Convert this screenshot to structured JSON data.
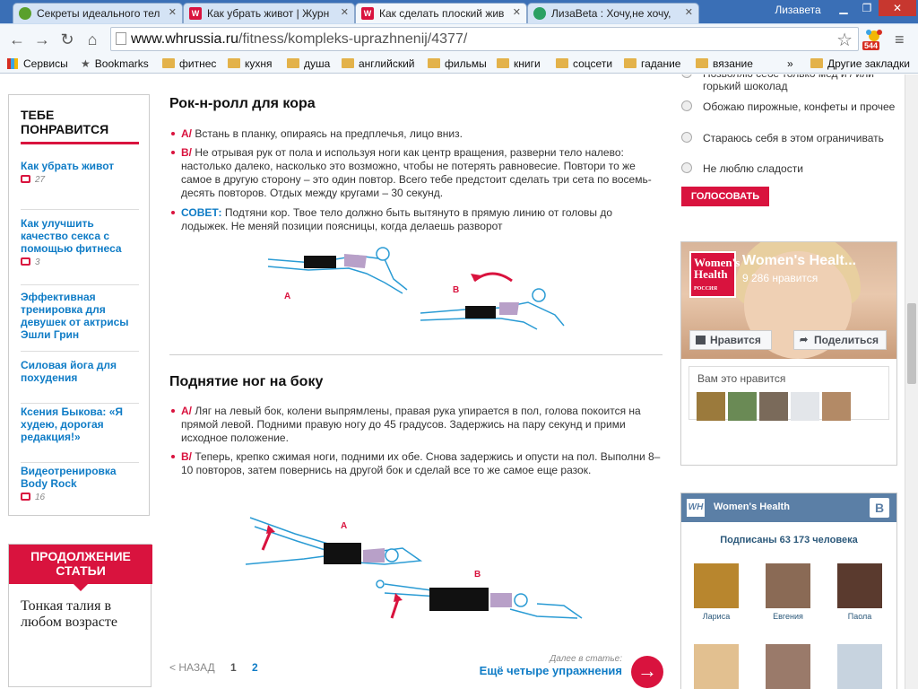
{
  "browser": {
    "tabs": [
      {
        "title": "Секреты идеального тел",
        "icon": "chrome-app-icon"
      },
      {
        "title": "Как убрать живот | Журн",
        "icon": "wh-favicon"
      },
      {
        "title": "Как сделать плоский жив",
        "icon": "wh-favicon"
      },
      {
        "title": "ЛизаBeta : Хочу,не хочу,",
        "icon": "liveinternet-favicon"
      }
    ],
    "user": "Лизавета",
    "url_domain": "www.whrussia.ru",
    "url_path": "/fitness/kompleks-uprazhnenij/4377/",
    "extension_badge": "544",
    "bookmarks": [
      "Сервисы",
      "Bookmarks",
      "фитнес",
      "кухня",
      "душа",
      "английский",
      "фильмы",
      "книги",
      "соцсети",
      "гадание",
      "вязание"
    ],
    "bookmarks_overflow": "»",
    "other_bookmarks": "Другие закладки"
  },
  "sidebar": {
    "title": "ТЕБЕ ПОНРАВИТСЯ",
    "items": [
      {
        "title": "Как убрать живот",
        "comments": "27"
      },
      {
        "title": "Как улучшить качество секса с помощью фитнеса",
        "comments": "3"
      },
      {
        "title": "Эффективная тренировка для девушек от актрисы Эшли Грин",
        "comments": ""
      },
      {
        "title": "Силовая йога для похудения",
        "comments": ""
      },
      {
        "title": "Ксения Быкова: «Я худею, дорогая редакция!»",
        "comments": ""
      },
      {
        "title": "Видеотренировка Body Rock",
        "comments": "16"
      }
    ],
    "continue_title": "ПРОДОЛЖЕНИЕ СТАТЬИ",
    "continue_text": "Тонкая талия в любом возрасте"
  },
  "article": {
    "section1": {
      "title": "Рок-н-ролл для кора",
      "a_label": "A/",
      "a_text": " Встань в планку, опираясь на предплечья, лицо вниз.",
      "b_label": "B/",
      "b_text": " Не отрывая рук от пола и используя ноги как центр вращения, разверни тело налево: настолько далеко, насколько это возможно, чтобы не потерять равновесие. Повтори то же самое в другую сторону – это один повтор. Всего тебе предстоит сделать три сета по восемь-десять повторов. Отдых между кругами – 30 секунд.",
      "tip_label": "СОВЕТ:",
      "tip_text": " Подтяни кор. Твое тело должно быть вытянуто в прямую линию от головы до лодыжек. Не меняй позиции поясницы, когда делаешь разворот",
      "fig_a": "A",
      "fig_b": "B"
    },
    "section2": {
      "title": "Поднятие ног на боку",
      "a_label": "A/",
      "a_text": " Ляг на левый бок, колени выпрямлены, правая рука упирается в пол, голова покоится на прямой левой. Подними правую ногу до 45 градусов. Задержись на пару секунд и прими исходное положение.",
      "b_label": "B/",
      "b_text": " Теперь, крепко сжимая ноги, подними их обе. Снова задержись и опусти на пол. Выполни 8–10 повторов, затем повернись на другой бок и сделай все то же самое еще разок.",
      "fig_a": "A",
      "fig_b": "B"
    },
    "pager": {
      "back": "< НАЗАД",
      "page1": "1",
      "page2": "2"
    },
    "next": {
      "small": "Далее в статье:",
      "big": "Ещё четыре упражнения",
      "arrow": "→"
    }
  },
  "poll": {
    "options": [
      "Позволяю себе только мед и / или горький шоколад",
      "Обожаю пирожные, конфеты и прочее",
      "Стараюсь себя в этом ограничивать",
      "Не люблю сладости"
    ],
    "vote_label": "ГОЛОСОВАТЬ"
  },
  "facebook": {
    "logo_text": "Women's Health",
    "logo_sub": "РОССИЯ",
    "page_name": "Women's Healt...",
    "likes": "9 286 нравится",
    "like_btn": "Нравится",
    "share_btn": "Поделиться",
    "friends_label": "Вам это нравится"
  },
  "vk": {
    "logo": "WH",
    "title": "Women's Health",
    "vk_letter": "B",
    "subscribers": "Подписаны 63 173 человека",
    "members": [
      "Лариса",
      "Евгения",
      "Паола"
    ]
  }
}
